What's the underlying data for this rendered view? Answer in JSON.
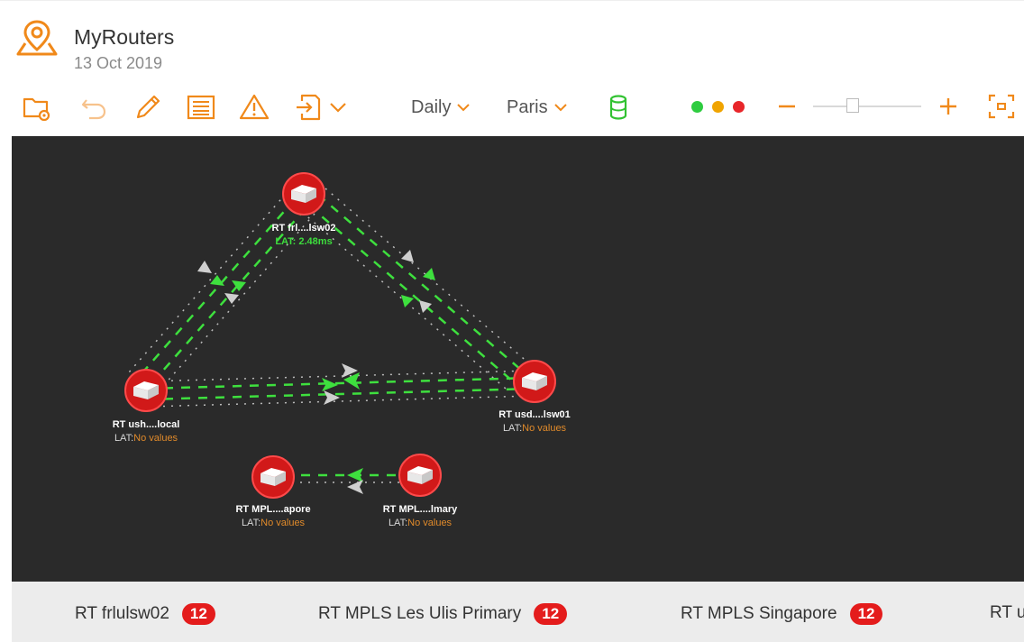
{
  "app": {
    "title": "MyRouters",
    "date": "13 Oct 2019"
  },
  "toolbar": {
    "icons": [
      "folder-settings-icon",
      "undo-icon",
      "pencil-icon",
      "list-icon",
      "warning-icon",
      "export-icon",
      "chevron-down-icon",
      "database-icon",
      "zoom-out-icon",
      "zoom-in-icon",
      "fit-screen-icon"
    ],
    "period_label": "Daily",
    "location_label": "Paris",
    "status_dots": [
      "#2ecc40",
      "#f0a400",
      "#e8262a"
    ],
    "zoom_minus": "−",
    "zoom_plus": "+",
    "accent_color": "#f0891a",
    "database_color": "#32c232"
  },
  "map": {
    "background": "#2a2a2a",
    "nodes": [
      {
        "name": "RT frl....lsw02",
        "lat": "LAT: 2.48ms"
      },
      {
        "name": "RT ush....local",
        "lat_prefix": "LAT:",
        "lat_value": "No values"
      },
      {
        "name": "RT usd....lsw01",
        "lat_prefix": "LAT:",
        "lat_value": "No values"
      },
      {
        "name": "RT MPL....apore",
        "lat_prefix": "LAT:",
        "lat_value": "No values"
      },
      {
        "name": "RT MPL....lmary",
        "lat_prefix": "LAT:",
        "lat_value": "No values"
      }
    ]
  },
  "footer": {
    "items": [
      {
        "label": "RT frlulsw02",
        "count": "12"
      },
      {
        "label": "RT MPLS Les Ulis Primary",
        "count": "12"
      },
      {
        "label": "RT MPLS Singapore",
        "count": "12"
      },
      {
        "label": "RT u",
        "count": ""
      }
    ]
  }
}
